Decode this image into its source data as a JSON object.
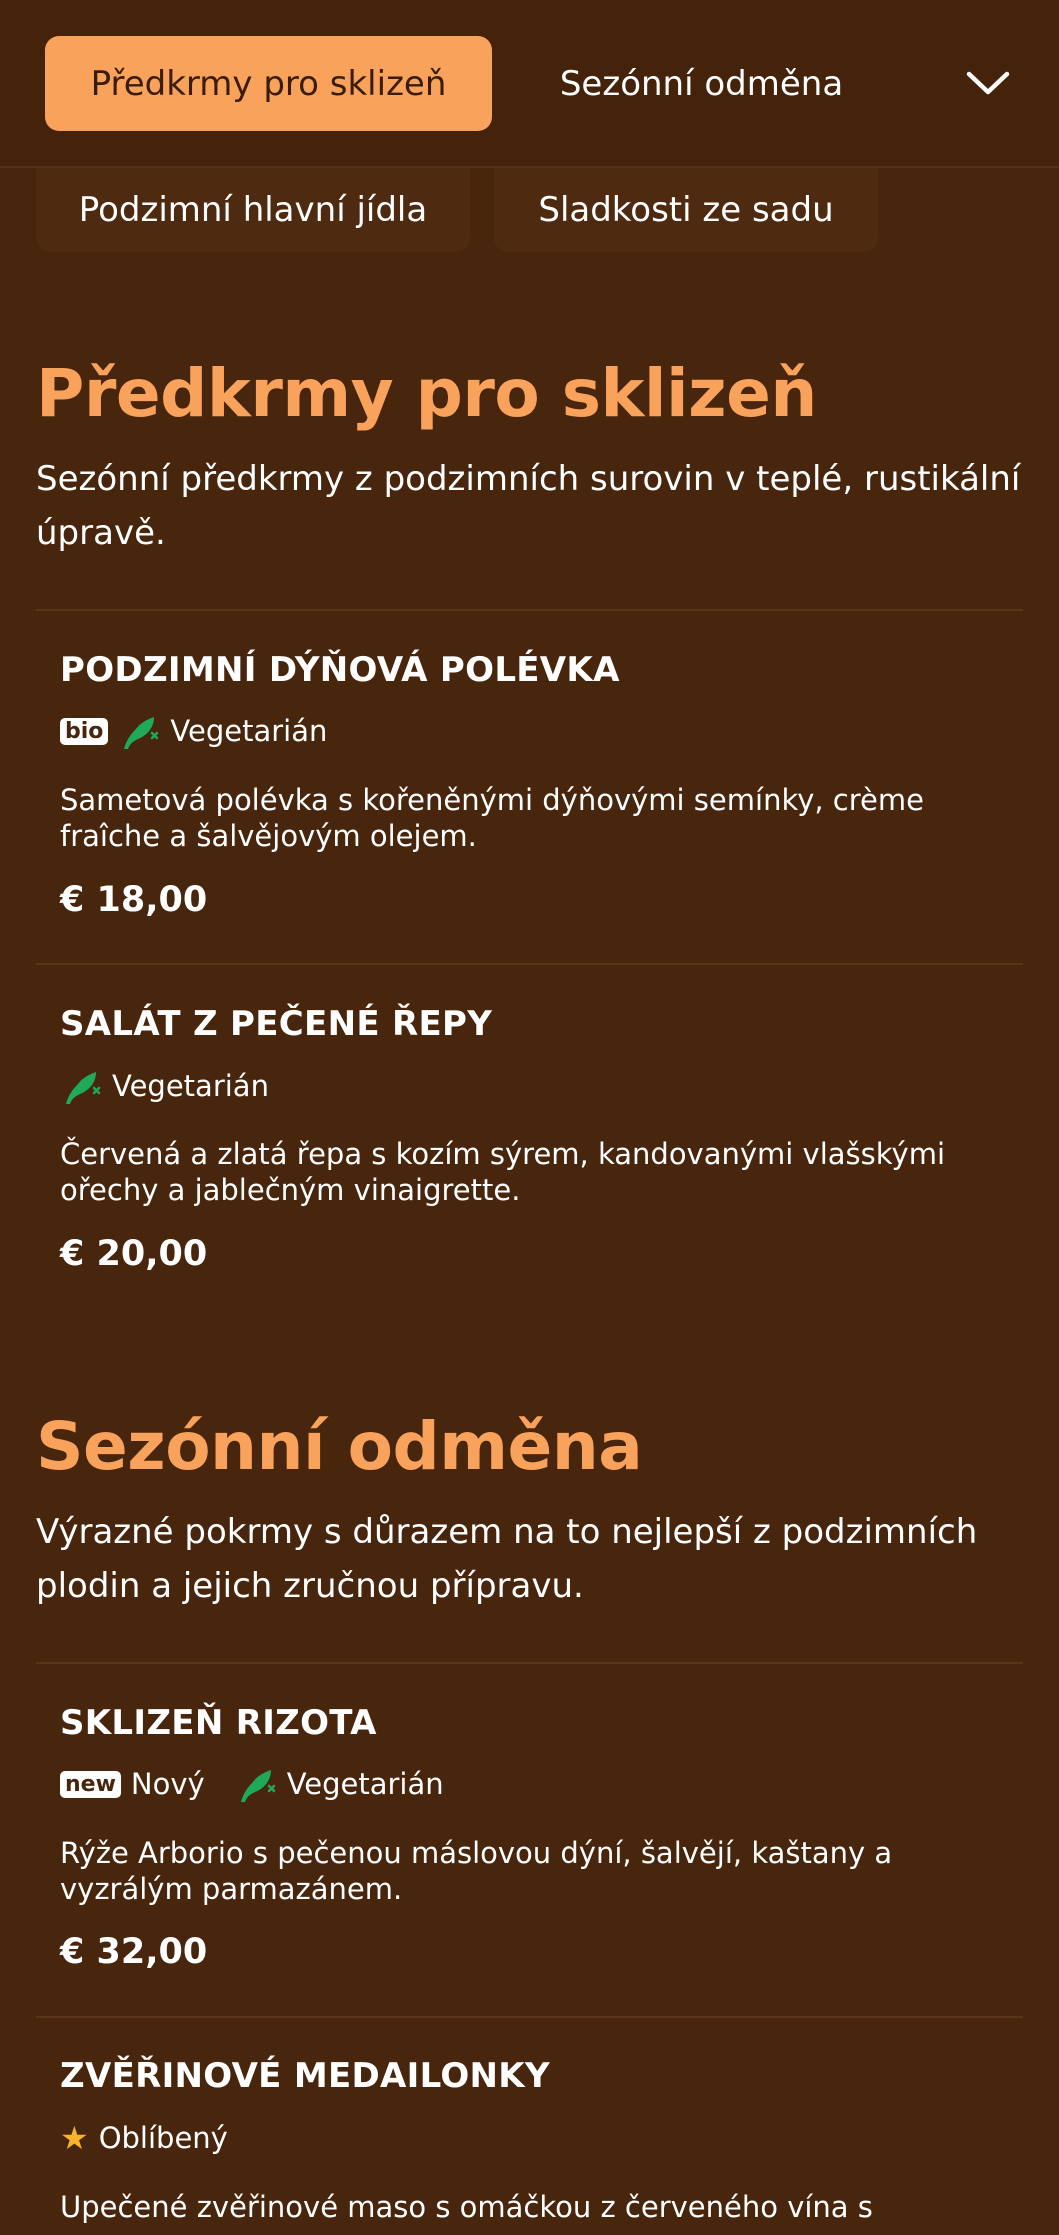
{
  "nav": {
    "active_tab": "Předkrmy pro sklizeň",
    "tabs": [
      "Sezónní odměna",
      "Podzimní hlavní jídla",
      "Sladkosti ze sadu"
    ]
  },
  "sections": [
    {
      "title": "Předkrmy pro sklizeň",
      "description": "Sezónní předkrmy z podzimních surovin v teplé, rustikální úpravě.",
      "items": [
        {
          "name": "PODZIMNÍ DÝŇOVÁ POLÉVKA",
          "badge": "bio",
          "tag": "Vegetarián",
          "description": "Sametová polévka s kořeněnými dýňovými semínky, crème fraîche a šalvějovým olejem.",
          "price": "€ 18,00"
        },
        {
          "name": "SALÁT Z PEČENÉ ŘEPY",
          "tag": "Vegetarián",
          "description": "Červená a zlatá řepa s kozím sýrem, kandovanými vlašskými ořechy a jablečným vinaigrette.",
          "price": "€ 20,00"
        }
      ]
    },
    {
      "title": "Sezónní odměna",
      "description": "Výrazné pokrmy s důrazem na to nejlepší z podzimních plodin a jejich zručnou přípravu.",
      "items": [
        {
          "name": "SKLIZEŇ RIZOTA",
          "badge": "new",
          "badge_label": "Nový",
          "tag": "Vegetarián",
          "description": "Rýže Arborio s pečenou máslovou dýní, šalvějí, kaštany a vyzrálým parmazánem.",
          "price": "€ 32,00"
        },
        {
          "name": "ZVĚŘINOVÉ MEDAILONKY",
          "tag": "Oblíbený",
          "description": "Upečené zvěřinové maso s omáčkou z červeného vína s"
        }
      ]
    }
  ],
  "icons": {
    "vegetarian": "leaf-icon",
    "popular": "star-icon",
    "expand": "chevron-down-icon"
  },
  "colors": {
    "background": "#48250d",
    "accent": "#f9a25b",
    "vegetarian": "#1faa59",
    "star": "#f7b32b"
  }
}
